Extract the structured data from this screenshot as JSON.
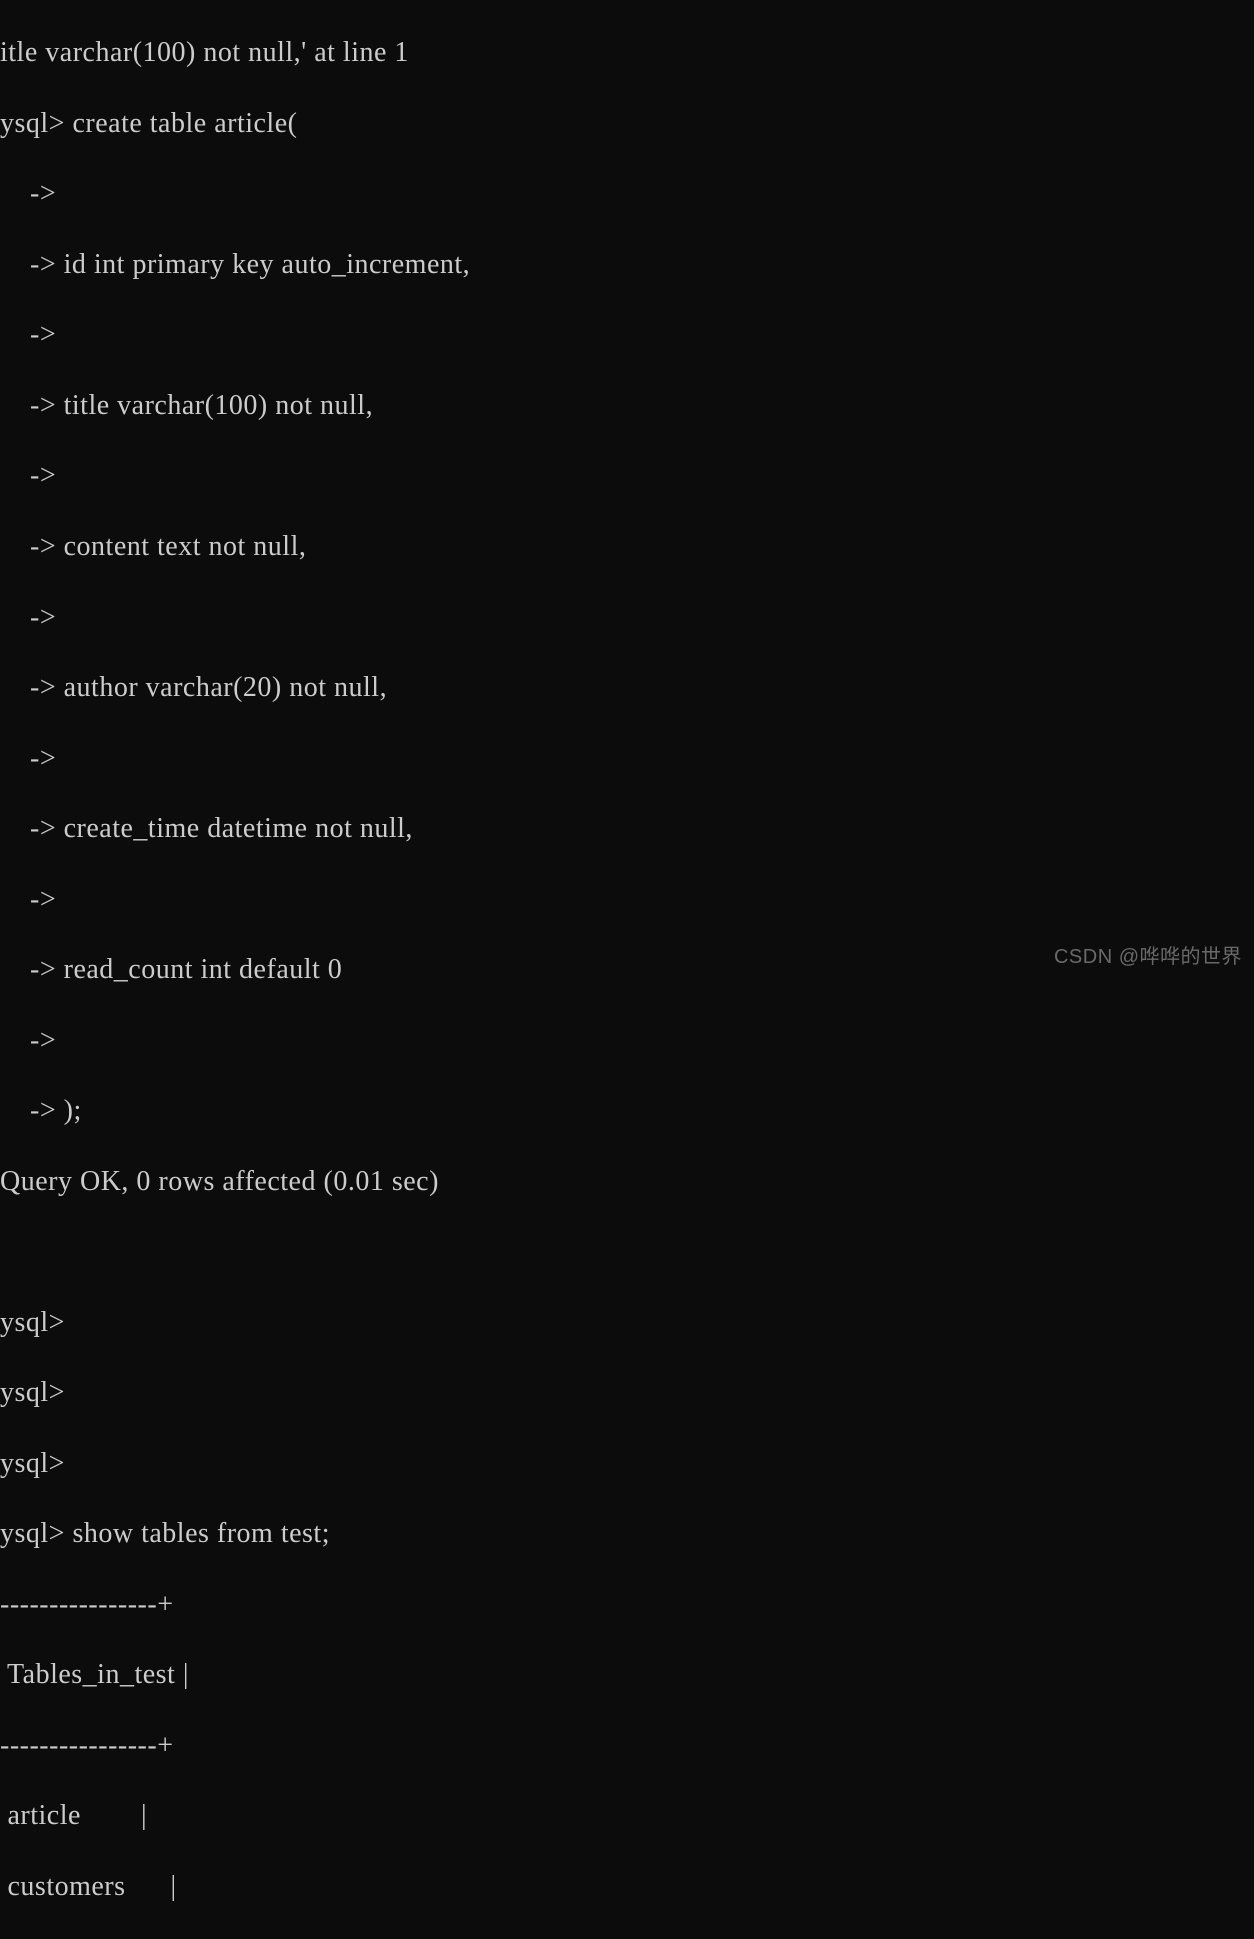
{
  "terminal": {
    "lines": [
      "itle varchar(100) not null,' at line 1",
      "ysql> create table article(",
      "    ->",
      "    -> id int primary key auto_increment,",
      "    ->",
      "    -> title varchar(100) not null,",
      "    ->",
      "    -> content text not null,",
      "    ->",
      "    -> author varchar(20) not null,",
      "    ->",
      "    -> create_time datetime not null,",
      "    ->",
      "    -> read_count int default 0",
      "    ->",
      "    -> );",
      "Query OK, 0 rows affected (0.01 sec)",
      "",
      "ysql>",
      "ysql>",
      "ysql>",
      "ysql> show tables from test;",
      "----------------+",
      " Tables_in_test |",
      "----------------+",
      " article        |",
      " customers      |"
    ]
  },
  "watermark": {
    "text": "CSDN @哗哗的世界"
  }
}
